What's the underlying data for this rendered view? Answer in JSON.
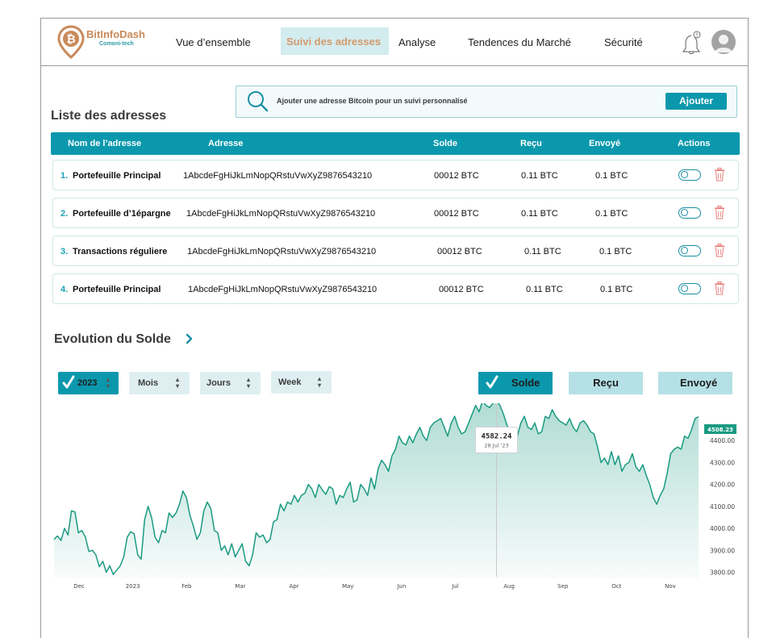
{
  "brand": {
    "name": "BitInfoDash",
    "tagline": "Comoni-tech",
    "logo_icon": "bitcoin-location-pin-icon"
  },
  "nav": {
    "items": [
      "Vue d’ensemble",
      "Analyse",
      "Tendences du Marché",
      "Sécurité"
    ],
    "active": "Suivi des adresses",
    "icons": [
      "bell-alert-icon",
      "user-avatar-icon"
    ]
  },
  "addresses": {
    "title": "Liste des adresses",
    "search_placeholder": "Ajouter une adresse Bitcoin pour un suivi personnalisé",
    "add_label": "Ajouter",
    "columns": [
      "Nom de l’adresse",
      "Adresse",
      "Solde",
      "Reçu",
      "Envoyé",
      "Actions"
    ],
    "rows": [
      {
        "index": "1.",
        "name": "Portefeuille Principal",
        "address": "1AbcdeFgHiJkLmNopQRstuVwXyZ9876543210",
        "balance": "00012 BTC",
        "received": "0.11 BTC",
        "sent": "0.1 BTC"
      },
      {
        "index": "2.",
        "name": "Portefeuille d’1épargne",
        "address": "1AbcdeFgHiJkLmNopQRstuVwXyZ9876543210",
        "balance": "00012 BTC",
        "received": "0.11 BTC",
        "sent": "0.1 BTC"
      },
      {
        "index": "3.",
        "name": "Transactions réguliere",
        "address": "1AbcdeFgHiJkLmNopQRstuVwXyZ9876543210",
        "balance": "00012 BTC",
        "received": "0.11 BTC",
        "sent": "0.1 BTC"
      },
      {
        "index": "4.",
        "name": "Portefeuille Principal",
        "address": "1AbcdeFgHiJkLmNopQRstuVwXyZ9876543210",
        "balance": "00012 BTC",
        "received": "0.11 BTC",
        "sent": "0.1 BTC"
      }
    ]
  },
  "evolution": {
    "title": "Evolution du Solde",
    "filters": {
      "year": "2023",
      "month": "Mois",
      "day": "Jours",
      "week": "Week"
    },
    "segments": {
      "balance": "Solde",
      "received": "Reçu",
      "sent": "Envoyé",
      "active": "Solde"
    }
  },
  "colors": {
    "accent": "#0b98ad",
    "accent_light": "#d3ecef",
    "brand_orange": "#c98a5a",
    "line": "#1a9a82",
    "danger": "#e0544f"
  },
  "chart_data": {
    "type": "area",
    "x_ticks": [
      "Dec",
      "2023",
      "Feb",
      "Mar",
      "Apr",
      "May",
      "Jun",
      "Jul",
      "Aug",
      "Sep",
      "Oct",
      "Nov"
    ],
    "y_ticks": [
      "4400.00",
      "4300.00",
      "4200.00",
      "4100.00",
      "4000.00",
      "3900.00",
      "3800.00"
    ],
    "ylim": [
      3780,
      4540
    ],
    "current_value": "4508.23",
    "tooltip": {
      "value": "4582.24",
      "date": "28 Jul '23"
    },
    "series": [
      {
        "values": [
          3950,
          3965,
          3945,
          4000,
          3970,
          4080,
          4075,
          3980,
          3990,
          3960,
          3895,
          3900,
          3880,
          3825,
          3850,
          3800,
          3830,
          3790,
          3810,
          3830,
          3870,
          3960,
          3985,
          3975,
          3880,
          3860,
          4040,
          4100,
          4050,
          3960,
          3935,
          3990,
          3980,
          4070,
          4050,
          4070,
          4110,
          4170,
          4140,
          4060,
          4010,
          3950,
          3980,
          4080,
          4120,
          4090,
          3990,
          3980,
          3900,
          3920,
          3880,
          3930,
          3870,
          3900,
          3930,
          3850,
          3830,
          3880,
          3980,
          3960,
          3970,
          3935,
          3950,
          4030,
          4040,
          4110,
          4080,
          4120,
          4110,
          4150,
          4120,
          4150,
          4160,
          4200,
          4180,
          4140,
          4200,
          4175,
          4155,
          4190,
          4180,
          4110,
          4150,
          4140,
          4180,
          4210,
          4120,
          4130,
          4200,
          4180,
          4150,
          4230,
          4180,
          4270,
          4310,
          4290,
          4260,
          4330,
          4360,
          4420,
          4390,
          4380,
          4420,
          4390,
          4430,
          4460,
          4420,
          4400,
          4460,
          4480,
          4490,
          4500,
          4460,
          4420,
          4480,
          4510,
          4460,
          4430,
          4440,
          4480,
          4520,
          4560,
          4530,
          4580,
          4560,
          4550,
          4570,
          4582,
          4560,
          4520,
          4470,
          4440,
          4390,
          4420,
          4480,
          4510,
          4460,
          4450,
          4480,
          4430,
          4440,
          4510,
          4500,
          4540,
          4510,
          4490,
          4480,
          4470,
          4500,
          4460,
          4440,
          4480,
          4490,
          4470,
          4440,
          4430,
          4370,
          4300,
          4320,
          4290,
          4350,
          4290,
          4330,
          4260,
          4290,
          4300,
          4340,
          4280,
          4260,
          4290,
          4240,
          4200,
          4140,
          4110,
          4150,
          4180,
          4250,
          4340,
          4360,
          4370,
          4360,
          4420,
          4410,
          4450,
          4500,
          4508
        ]
      }
    ]
  }
}
